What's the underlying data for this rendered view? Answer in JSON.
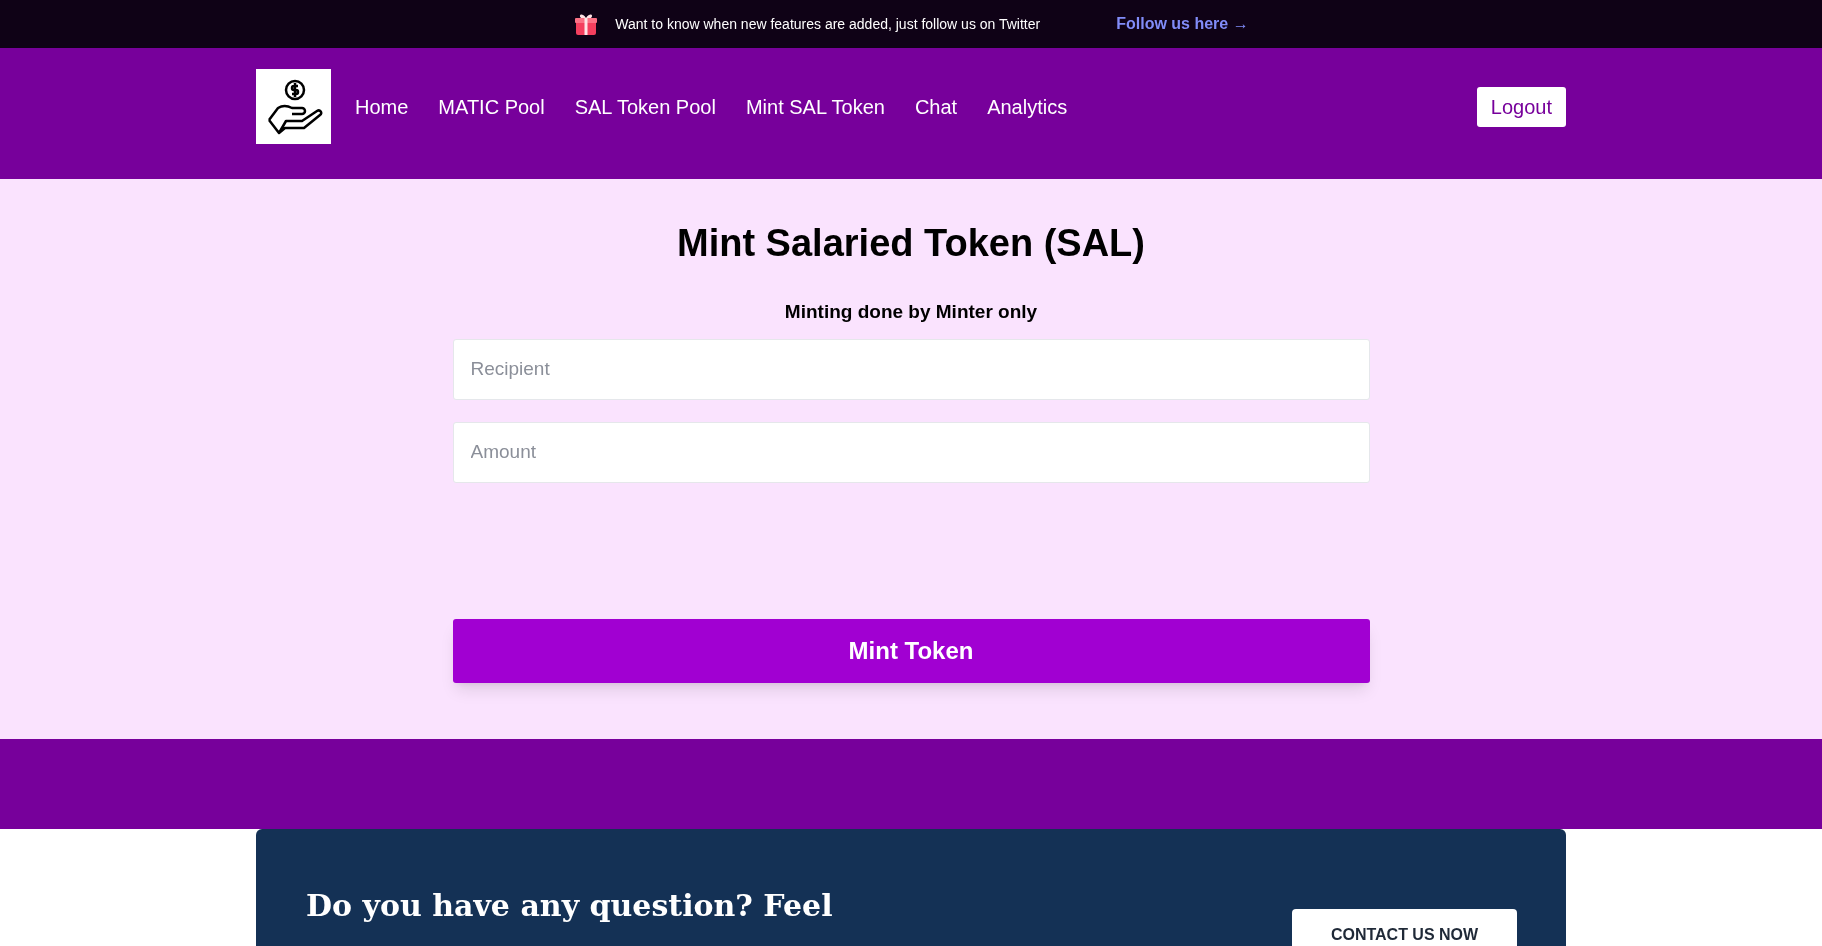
{
  "announcement": {
    "text": "Want to know when new features are added, just follow us on Twitter",
    "link": "Follow us here →"
  },
  "nav": {
    "links": [
      {
        "label": "Home"
      },
      {
        "label": "MATIC Pool"
      },
      {
        "label": "SAL Token Pool"
      },
      {
        "label": "Mint SAL Token"
      },
      {
        "label": "Chat"
      },
      {
        "label": "Analytics"
      }
    ],
    "logout": "Logout"
  },
  "form": {
    "title": "Mint Salaried Token (SAL)",
    "subtitle": "Minting done by Minter only",
    "fields": [
      {
        "placeholder": "Recipient"
      },
      {
        "placeholder": "Amount"
      }
    ],
    "submit": "Mint Token"
  },
  "contact": {
    "heading": "Do you have any question? Feel",
    "button": "CONTACT US NOW"
  }
}
